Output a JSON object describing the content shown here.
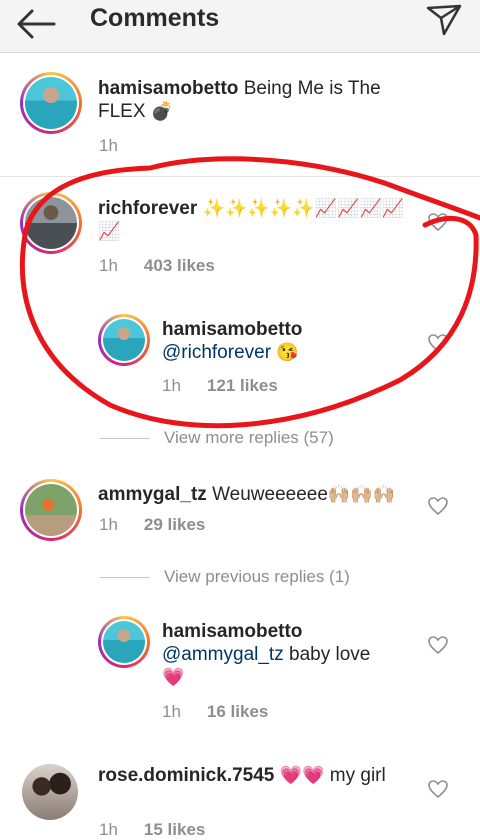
{
  "header": {
    "title": "Comments"
  },
  "caption": {
    "username": "hamisamobetto",
    "text": "Being Me is The FLEX",
    "emoji": "💣",
    "time": "1h"
  },
  "comments": [
    {
      "username": "richforever",
      "emoji": "✨✨✨✨✨📈📈📈📈📈",
      "time": "1h",
      "likes": "403 likes",
      "reply": {
        "username": "hamisamobetto",
        "mention": "@richforever",
        "emoji": "😘",
        "time": "1h",
        "likes": "121 likes"
      },
      "view_replies": "View more replies (57)"
    },
    {
      "username": "ammygal_tz",
      "text": "Weuweeeeee",
      "emoji": "🙌🏼🙌🏼🙌🏼",
      "time": "1h",
      "likes": "29 likes",
      "view_replies": "View previous replies (1)",
      "reply": {
        "username": "hamisamobetto",
        "mention": "@ammygal_tz",
        "text": "baby love",
        "emoji": "💗",
        "time": "1h",
        "likes": "16 likes"
      }
    },
    {
      "username": "rose.dominick.7545",
      "emoji": "💗💗",
      "text": "my girl",
      "time": "1h",
      "likes": "15 likes"
    }
  ],
  "icons": {
    "back": "back-arrow-icon",
    "send": "send-icon",
    "like": "heart-icon"
  },
  "colors": {
    "annotation": "#e8161a",
    "mention": "#003569",
    "heart": "#e0457b"
  }
}
